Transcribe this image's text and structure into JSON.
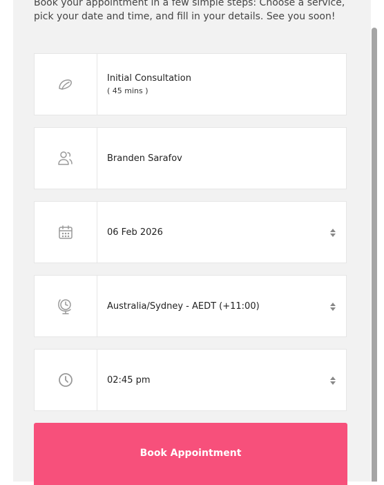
{
  "intro": {
    "text": "Book your appointment in a few simple steps: Choose a service, pick your date and time, and fill in your details. See you soon!"
  },
  "service": {
    "icon": "service-icon",
    "name": "Initial Consultation",
    "duration": "( 45 mins )"
  },
  "staff": {
    "icon": "users-icon",
    "name": "Branden Sarafov"
  },
  "date": {
    "icon": "calendar-icon",
    "value": "06 Feb 2026"
  },
  "timezone": {
    "icon": "globe-clock-icon",
    "value": "Australia/Sydney - AEDT (+11:00)"
  },
  "time": {
    "icon": "clock-icon",
    "value": "02:45 pm"
  },
  "actions": {
    "book_label": "Book Appointment"
  },
  "colors": {
    "accent": "#f7507b",
    "background": "#f2f2f2",
    "icon": "#999999"
  }
}
